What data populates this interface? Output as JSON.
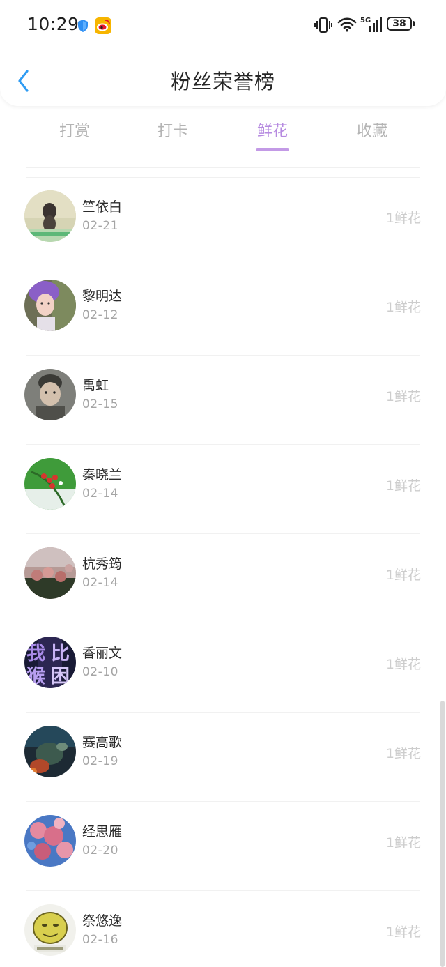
{
  "status_bar": {
    "time": "10:29",
    "battery": "38",
    "network": "5G",
    "icons": [
      "shield-icon",
      "weibo-icon",
      "vibrate-icon",
      "wifi-icon",
      "signal-icon",
      "battery-icon"
    ]
  },
  "header": {
    "title": "粉丝荣誉榜",
    "back_icon": "chevron-left-icon"
  },
  "tabs": [
    {
      "label": "打赏",
      "active": false
    },
    {
      "label": "打卡",
      "active": false
    },
    {
      "label": "鲜花",
      "active": true
    },
    {
      "label": "收藏",
      "active": false
    }
  ],
  "colors": {
    "accent": "#b68ae0",
    "back_arrow": "#2f9cf3",
    "inactive_tab": "#b4b4b4",
    "amount_text": "#cdcdcd"
  },
  "fans": [
    {
      "name": "竺依白",
      "date": "02-21",
      "amount": "1鲜花"
    },
    {
      "name": "黎明达",
      "date": "02-12",
      "amount": "1鲜花"
    },
    {
      "name": "禹虹",
      "date": "02-15",
      "amount": "1鲜花"
    },
    {
      "name": "秦晓兰",
      "date": "02-14",
      "amount": "1鲜花"
    },
    {
      "name": "杭秀筠",
      "date": "02-14",
      "amount": "1鲜花"
    },
    {
      "name": "香丽文",
      "date": "02-10",
      "amount": "1鲜花",
      "avatar_text": [
        "我",
        "比",
        "猴",
        "困"
      ]
    },
    {
      "name": "赛高歌",
      "date": "02-19",
      "amount": "1鲜花"
    },
    {
      "name": "经思雁",
      "date": "02-20",
      "amount": "1鲜花"
    },
    {
      "name": "祭悠逸",
      "date": "02-16",
      "amount": "1鲜花"
    }
  ]
}
